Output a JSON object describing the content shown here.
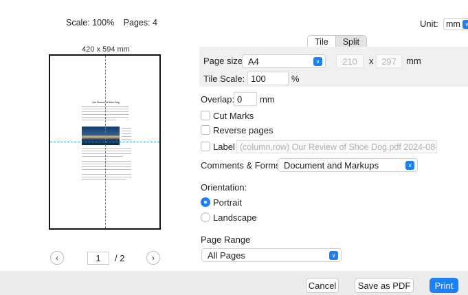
{
  "preview": {
    "scale_label": "Scale: 100%",
    "pages_label": "Pages: 4",
    "page_dims": "420 x 594 mm",
    "mini_title": "Our Review of Shoe Dog",
    "current_page": "1",
    "total_pages": "/ 2"
  },
  "unit": {
    "label": "Unit:",
    "value": "mm"
  },
  "mode_tabs": {
    "tile": "Tile",
    "split": "Split"
  },
  "tile": {
    "page_size_label": "Page size:",
    "page_size_value": "A4",
    "width": "210",
    "x": "x",
    "height": "297",
    "size_unit": "mm",
    "tile_scale_label": "Tile Scale:",
    "tile_scale_value": "100",
    "tile_scale_unit": "%"
  },
  "overlap": {
    "label": "Overlap:",
    "value": "0",
    "unit": "mm"
  },
  "options": {
    "cut_marks": "Cut Marks",
    "reverse_pages": "Reverse pages",
    "label": "Label",
    "label_placeholder": "(column,row) Our Review of Shoe Dog.pdf 2024-08-..."
  },
  "comments": {
    "label": "Comments & Forms:",
    "value": "Document and Markups"
  },
  "orientation": {
    "label": "Orientation:",
    "portrait": "Portrait",
    "landscape": "Landscape",
    "selected": "Portrait"
  },
  "page_range": {
    "label": "Page Range",
    "value": "All Pages"
  },
  "buttons": {
    "cancel": "Cancel",
    "save_pdf": "Save as PDF",
    "print": "Print"
  },
  "colors": {
    "accent": "#1f7ff5",
    "guide": "#2b8fd6"
  }
}
